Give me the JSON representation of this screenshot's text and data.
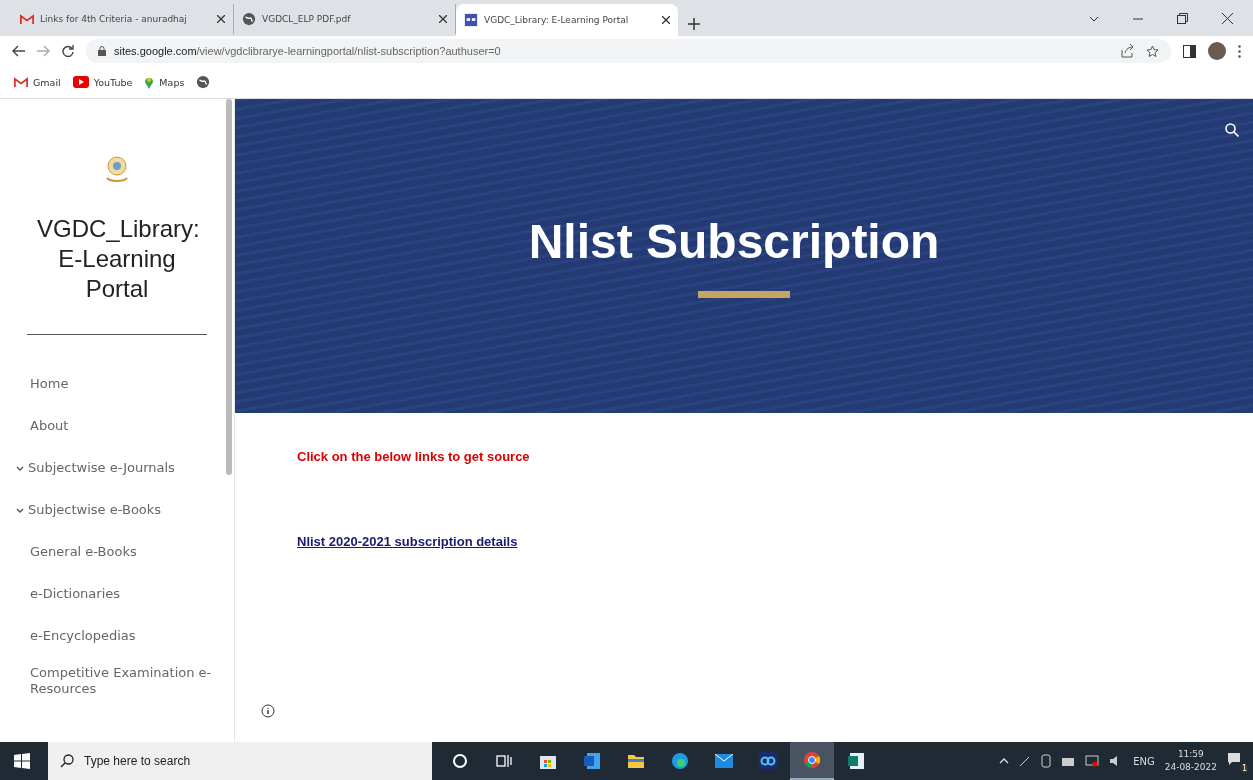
{
  "browser": {
    "tabs": [
      {
        "label": "Links for 4th Criteria - anuradhaj",
        "kind": "mail",
        "selected": false
      },
      {
        "label": "VGDCL_ELP PDF.pdf",
        "kind": "globe",
        "selected": false
      },
      {
        "label": "VGDC_Library: E-Learning Portal",
        "kind": "site",
        "selected": true
      }
    ],
    "url_host": "sites.google.com",
    "url_path": "/view/vgdclibrarye-learningportal/nlist-subscription?authuser=0",
    "bookmarks": [
      {
        "label": "Gmail",
        "kind": "mail"
      },
      {
        "label": "YouTube",
        "kind": "play"
      },
      {
        "label": "Maps",
        "kind": "pin"
      },
      {
        "kind": "globe"
      }
    ]
  },
  "sidebar": {
    "site_title": "VGDC_Library: E-Learning Portal",
    "items": [
      {
        "label": "Home",
        "kind": "link"
      },
      {
        "label": "About",
        "kind": "link"
      },
      {
        "label": "Subjectwise e-Journals",
        "kind": "group"
      },
      {
        "label": "Subjectwise e-Books",
        "kind": "group"
      },
      {
        "label": "General e-Books",
        "kind": "link"
      },
      {
        "label": "e-Dictionaries",
        "kind": "link"
      },
      {
        "label": "e-Encyclopedias",
        "kind": "link"
      },
      {
        "label": "Competitive Examination e-Resources",
        "kind": "link"
      }
    ]
  },
  "banner": {
    "title": "Nlist Subscription"
  },
  "content": {
    "notice": "Click on the below links to get source",
    "link": "Nlist 2020-2021 subscription details"
  },
  "taskbar": {
    "search_placeholder": "Type here to search",
    "apps": [
      {
        "kind": "cortana",
        "active": false
      },
      {
        "kind": "taskview",
        "active": false
      },
      {
        "kind": "store",
        "active": false
      },
      {
        "kind": "word",
        "active": false
      },
      {
        "kind": "folder",
        "active": false
      },
      {
        "kind": "edge",
        "active": false
      },
      {
        "kind": "mail",
        "active": false
      },
      {
        "kind": "app",
        "active": false
      },
      {
        "kind": "chrome",
        "active": true
      },
      {
        "kind": "publisher",
        "active": false
      }
    ],
    "language": "ENG",
    "time": "11:59",
    "date": "24-08-2022",
    "notifications": "1"
  }
}
